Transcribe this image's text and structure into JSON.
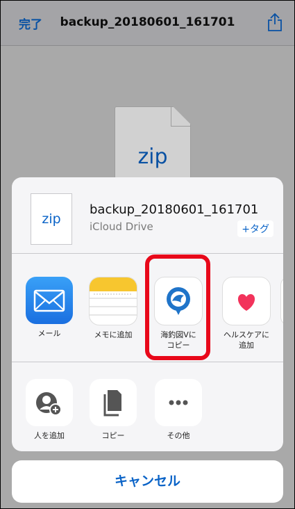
{
  "nav": {
    "done_label": "完了",
    "title": "backup_20180601_161701",
    "share_icon": "share-icon"
  },
  "preview": {
    "file_ext": "zip"
  },
  "sheet": {
    "file_ext": "zip",
    "file_name": "backup_20180601_161701",
    "location": "iCloud Drive",
    "tag_label": "+タグ",
    "apps": [
      {
        "label": "メール",
        "icon": "mail-icon"
      },
      {
        "label": "メモに追加",
        "icon": "notes-icon"
      },
      {
        "label": "海釣図Vにコピー",
        "label_line2": "コピー",
        "label_line1": "海釣図Vに",
        "icon": "kaichouzu-v-icon"
      },
      {
        "label_line1": "ヘルスケアに",
        "label_line2": "追加",
        "icon": "health-icon"
      }
    ],
    "actions": [
      {
        "label": "人を追加",
        "icon": "add-people-icon"
      },
      {
        "label": "コピー",
        "icon": "copy-icon"
      },
      {
        "label": "その他",
        "icon": "more-icon"
      }
    ],
    "cancel_label": "キャンセル"
  },
  "colors": {
    "accent": "#0a63c7",
    "highlight": "#e8081a"
  }
}
